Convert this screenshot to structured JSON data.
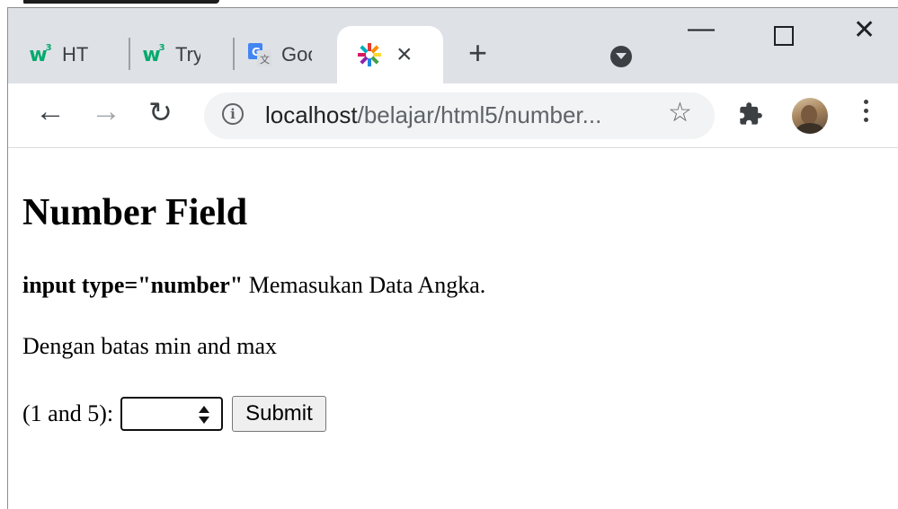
{
  "browser": {
    "tabs": [
      {
        "title": "HTML"
      },
      {
        "title": "Tryit"
      },
      {
        "title": "Google"
      },
      {
        "title": "",
        "close": "×"
      }
    ],
    "new_tab_label": "+",
    "window_controls": {
      "minimize": "—",
      "close": "✕"
    },
    "toolbar": {
      "back": "←",
      "forward": "→",
      "reload": "↻",
      "info_glyph": "i",
      "url_host": "localhost",
      "url_path": "/belajar/html5/number...",
      "star": "☆"
    },
    "icons": {
      "tab1_favicon": "w3schools-icon",
      "tab2_favicon": "w3schools-icon",
      "tab3_favicon": "google-translate-icon",
      "tab4_favicon": "colorful-star-icon",
      "tab_search": "tab-search-icon",
      "extensions": "puzzle-icon",
      "profile": "avatar",
      "menu": "kebab-menu-icon"
    }
  },
  "page": {
    "heading": "Number Field",
    "line1_bold": "input type=\"number\"",
    "line1_rest": " Memasukan Data Angka.",
    "line2": "Dengan batas min and max",
    "label": "(1 and 5):",
    "input_value": "",
    "submit_label": "Submit"
  },
  "colors": {
    "tab_strip": "#dee1e6",
    "omnibox": "#f1f3f4",
    "w3_green": "#04aa6d"
  }
}
